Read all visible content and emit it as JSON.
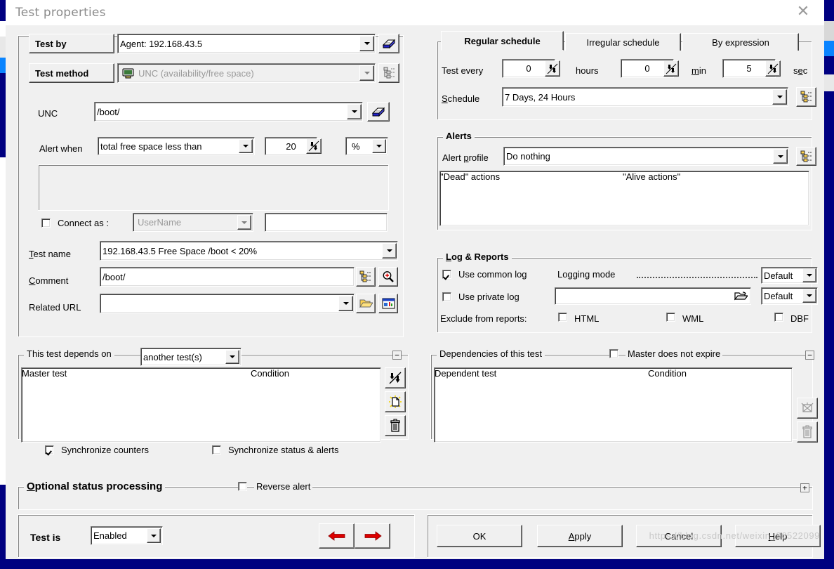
{
  "window": {
    "title": "Test properties",
    "close_icon": "close-icon"
  },
  "left": {
    "test_by": {
      "label": "Test by",
      "value": "Agent: 192.168.43.5",
      "book_icon": "book-icon"
    },
    "test_method": {
      "label": "Test method",
      "value": "UNC (availability/free space)",
      "monitor_icon": "monitor-icon",
      "tree_icon": "tree-list-icon"
    },
    "unc": {
      "label": "UNC",
      "value": "/boot/",
      "book_icon": "book-icon"
    },
    "alert_when": {
      "label": "Alert when",
      "condition": "total free space less than",
      "amount": "20",
      "unit": "%"
    },
    "connect_as": {
      "label": "Connect as :",
      "checked": false,
      "user_placeholder": "UserName",
      "password_value": ""
    },
    "test_name": {
      "label_pre": "T",
      "label_post": "est name",
      "value": "192.168.43.5 Free Space /boot < 20%"
    },
    "comment": {
      "label_pre": "C",
      "label_post": "omment",
      "value": "/boot/",
      "tree_icon": "tree-list-icon",
      "zoom_icon": "magnifier-plus-icon"
    },
    "related_url": {
      "label": "Related URL",
      "value": "",
      "folder_icon": "open-folder-icon",
      "report_icon": "report-window-icon"
    }
  },
  "right": {
    "schedule_tabs": [
      {
        "label": "Regular schedule",
        "active": true
      },
      {
        "label": "Irregular schedule",
        "active": false
      },
      {
        "label": "By expression",
        "active": false
      }
    ],
    "test_every": {
      "label": "Test every",
      "hours": "0",
      "hours_unit": "hours",
      "min": "0",
      "min_unit_pre": "m",
      "min_unit_post": "in",
      "sec": "5",
      "sec_unit_pre": "s",
      "sec_unit_mid": "e",
      "sec_unit_post": "c"
    },
    "schedule": {
      "label_pre": "S",
      "label_post": "chedule",
      "value": "7 Days, 24 Hours",
      "tree_icon": "tree-list-icon"
    },
    "alerts": {
      "title": "Alerts",
      "profile_label_pre": "Alert ",
      "profile_label_key": "p",
      "profile_label_post": "rofile",
      "profile_value": "Do nothing",
      "tree_icon": "tree-list-icon",
      "columns": [
        "\"Dead\" actions",
        "\"Alive actions\"",
        ""
      ],
      "rows": []
    },
    "logs": {
      "title_pre": "L",
      "title_post": "og & Reports",
      "use_common_log": {
        "label": "Use common log",
        "checked": true
      },
      "use_private_log": {
        "label": "Use private log",
        "checked": false
      },
      "logging_mode_label": "Logging mode",
      "logging_mode_value": "Default",
      "private_log_path": "",
      "private_log_mode_value": "Default",
      "folder_icon": "open-folder-icon",
      "exclude_label": "Exclude from reports:",
      "exclude_options": [
        {
          "label": "HTML",
          "checked": false
        },
        {
          "label": "WML",
          "checked": false
        },
        {
          "label": "DBF",
          "checked": false
        }
      ]
    }
  },
  "depends": {
    "title": "This test depends on",
    "mode": "another test(s)",
    "columns": [
      "Master test",
      "Condition"
    ],
    "rows": [],
    "sync_counters": {
      "label": "Synchronize counters",
      "checked": true
    },
    "sync_status": {
      "label": "Synchronize status & alerts",
      "checked": false
    },
    "collapse_sign": "−",
    "buttons": [
      "sort-icon",
      "new-document-icon",
      "delete-icon"
    ]
  },
  "dependencies": {
    "title": "Dependencies of this test",
    "master_no_expire": {
      "label": "Master does not expire",
      "checked": false
    },
    "columns": [
      "Dependent test",
      "Condition",
      ""
    ],
    "rows": [],
    "collapse_sign": "−",
    "buttons": [
      "broken-link-icon",
      "delete-icon"
    ]
  },
  "optional": {
    "title_pre": "O",
    "title_post": "ptional status processing",
    "reverse_alert": {
      "label": "Reverse alert",
      "checked": false
    },
    "expand_sign": "+"
  },
  "footer": {
    "test_is_label": "Test is",
    "test_is_value": "Enabled",
    "nav_prev_icon": "arrow-left-icon",
    "nav_next_icon": "arrow-right-icon",
    "buttons": [
      {
        "name": "ok-button",
        "pre": "",
        "key": "",
        "post": "OK"
      },
      {
        "name": "apply-button",
        "pre": "",
        "key": "A",
        "post": "pply"
      },
      {
        "name": "cancel-button",
        "pre": "",
        "key": "",
        "post": "Cancel"
      },
      {
        "name": "help-button",
        "pre": "",
        "key": "H",
        "post": "elp"
      }
    ]
  },
  "watermark": "https://blog.csdn.net/weixin_36522099"
}
